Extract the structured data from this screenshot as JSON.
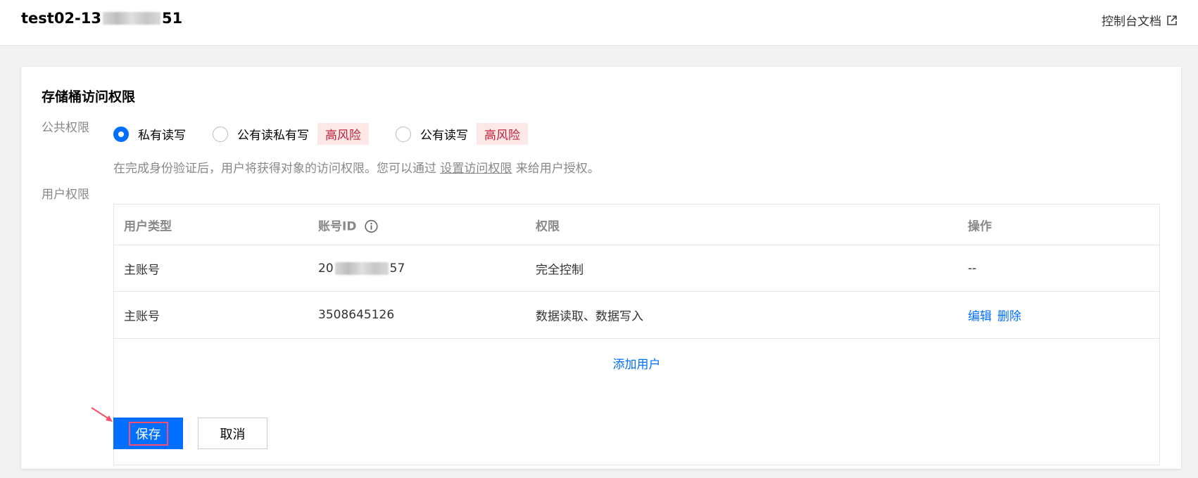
{
  "header": {
    "bucket_name_prefix": "test02-13",
    "bucket_name_suffix": "51",
    "doc_link": "控制台文档"
  },
  "section": {
    "title": "存储桶访问权限"
  },
  "public_permission": {
    "label": "公共权限",
    "options": [
      {
        "label": "私有读写",
        "checked": true,
        "risk": ""
      },
      {
        "label": "公有读私有写",
        "checked": false,
        "risk": "高风险"
      },
      {
        "label": "公有读写",
        "checked": false,
        "risk": "高风险"
      }
    ],
    "hint_before": "在完成身份验证后，用户将获得对象的访问权限。您可以通过",
    "hint_link": "设置访问权限",
    "hint_after": "来给用户授权。"
  },
  "user_permission": {
    "label": "用户权限",
    "columns": [
      "用户类型",
      "账号ID",
      "权限",
      "操作"
    ],
    "rows": [
      {
        "type": "主账号",
        "id_prefix": "20",
        "id_suffix": "57",
        "permission": "完全控制",
        "operation": "--"
      },
      {
        "type": "主账号",
        "id": "3508645126",
        "permission": "数据读取、数据写入",
        "edit": "编辑",
        "delete": "删除"
      }
    ],
    "add_user": "添加用户"
  },
  "actions": {
    "save": "保存",
    "cancel": "取消"
  },
  "colors": {
    "accent": "#006eff",
    "risk_bg": "#fde8e8",
    "risk_text": "#c0203a",
    "highlight": "#ff4d6d"
  }
}
